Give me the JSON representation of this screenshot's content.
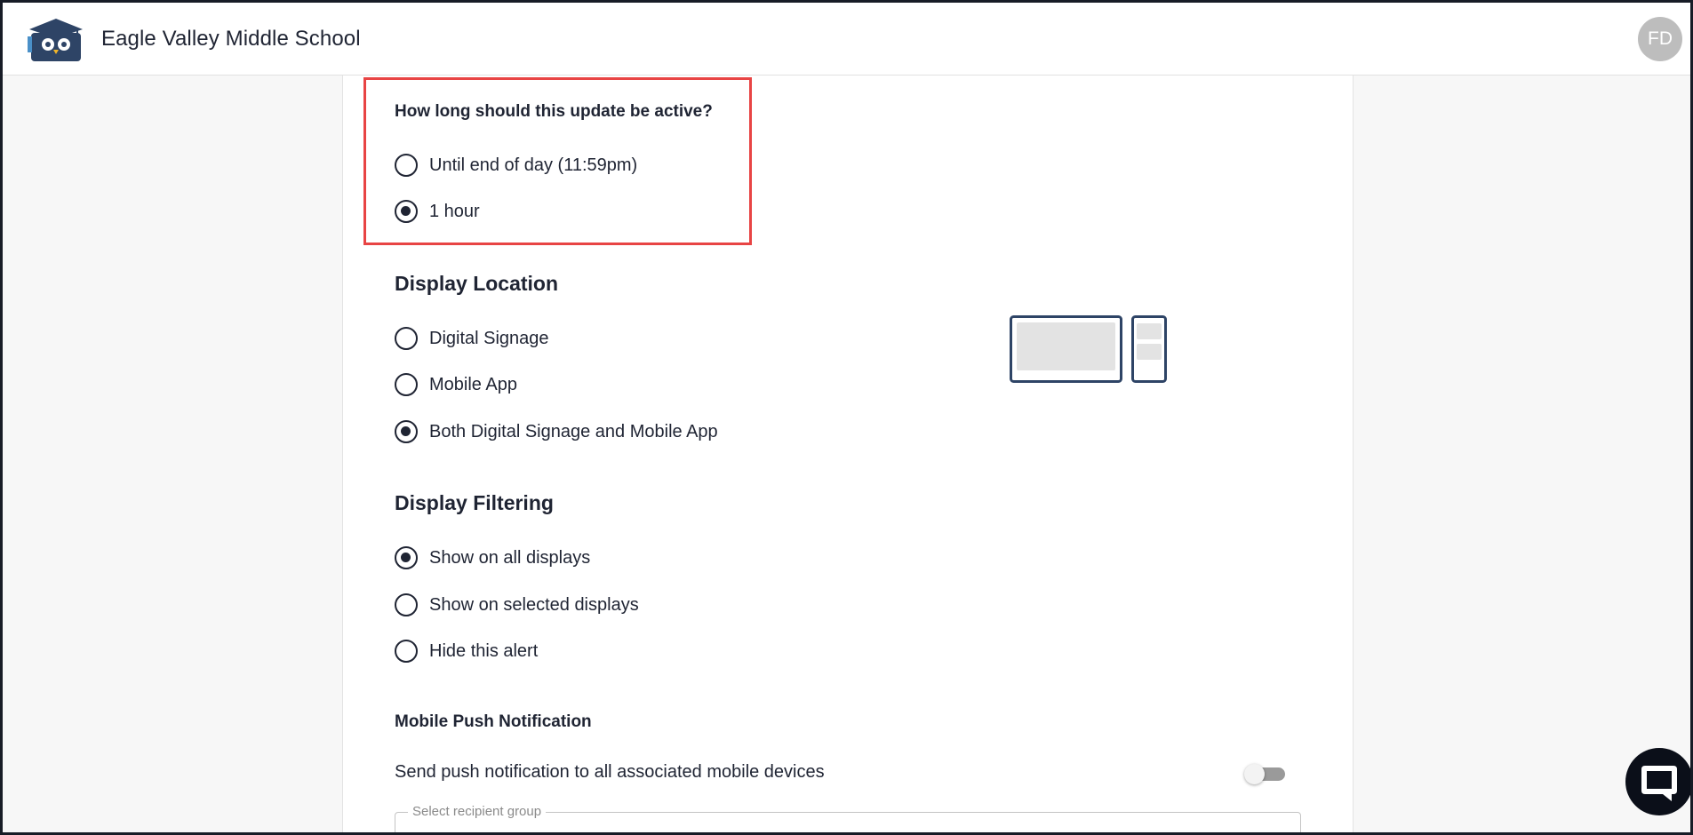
{
  "header": {
    "school_name": "Eagle Valley Middle School",
    "avatar_initials": "FD"
  },
  "duration": {
    "question": "How long should this update be active?",
    "options": [
      {
        "label": "Until end of day (11:59pm)",
        "selected": false
      },
      {
        "label": "1 hour",
        "selected": true
      }
    ]
  },
  "display_location": {
    "title": "Display Location",
    "options": [
      {
        "label": "Digital Signage",
        "selected": false
      },
      {
        "label": "Mobile App",
        "selected": false
      },
      {
        "label": "Both Digital Signage and Mobile App",
        "selected": true
      }
    ]
  },
  "display_filtering": {
    "title": "Display Filtering",
    "options": [
      {
        "label": "Show on all displays",
        "selected": true
      },
      {
        "label": "Show on selected displays",
        "selected": false
      },
      {
        "label": "Hide this alert",
        "selected": false
      }
    ]
  },
  "push_notification": {
    "title": "Mobile Push Notification",
    "description": "Send push notification to all associated mobile devices",
    "enabled": false,
    "recipient_label": "Select recipient group"
  },
  "colors": {
    "highlight": "#e84444",
    "text": "#1f2433",
    "brand": "#2e4466"
  }
}
